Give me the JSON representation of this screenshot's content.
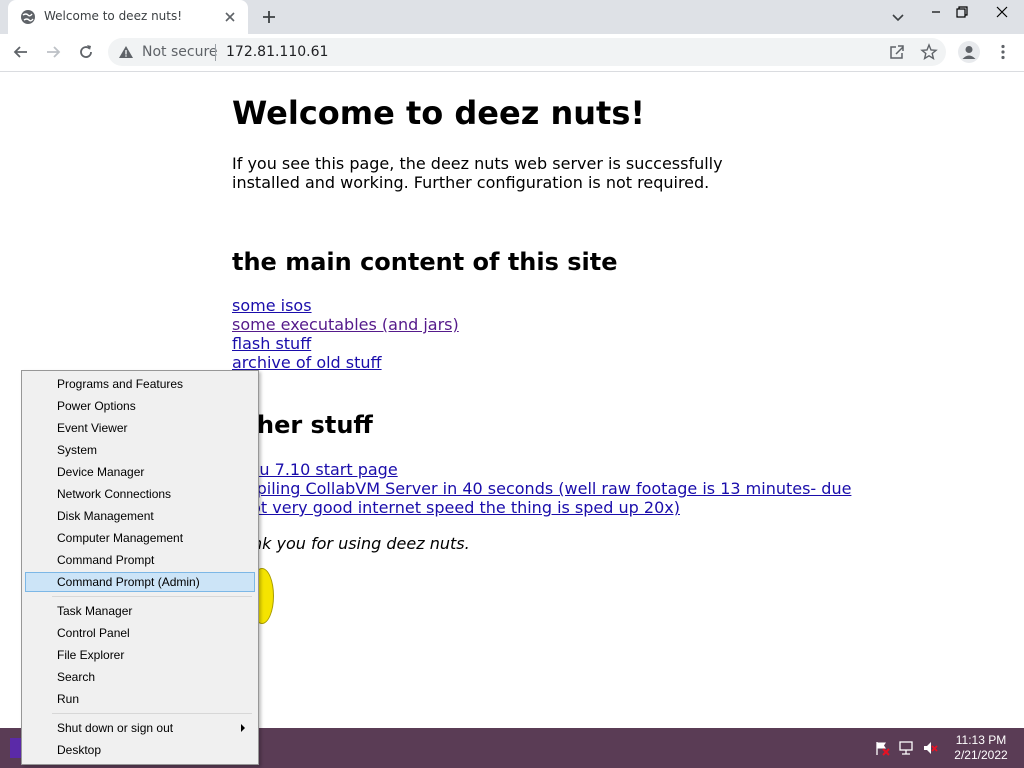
{
  "browser": {
    "tab_title": "Welcome to deez nuts!",
    "security_label": "Not secure",
    "url": "172.81.110.61"
  },
  "page": {
    "title": "Welcome to deez nuts!",
    "intro": "If you see this page, the deez nuts web server is successfully installed and working. Further configuration is not required.",
    "section1_heading": "the main content of this site",
    "section1_links": [
      "some isos",
      "some executables (and jars)",
      "flash stuff",
      "archive of old stuff"
    ],
    "section2_heading": "her stuff",
    "section2_links": [
      "ntu 7.10 start page",
      "mpiling CollabVM Server in 40 seconds (well raw footage is 13 minutes- due",
      "not very good internet speed the thing is sped up 20x)"
    ],
    "thanks": "nk you for using deez nuts."
  },
  "context_menu": {
    "items": [
      "Programs and Features",
      "Power Options",
      "Event Viewer",
      "System",
      "Device Manager",
      "Network Connections",
      "Disk Management",
      "Computer Management",
      "Command Prompt",
      "Command Prompt (Admin)",
      "Task Manager",
      "Control Panel",
      "File Explorer",
      "Search",
      "Run",
      "Shut down or sign out",
      "Desktop"
    ],
    "highlighted": "Command Prompt (Admin)"
  },
  "taskbar": {
    "time": "11:13 PM",
    "date": "2/21/2022"
  },
  "colors": {
    "link": "#1a0dab",
    "visited_link": "#551a8b",
    "taskbar": "#5a3c55",
    "menu_highlight": "#cce4f7"
  }
}
